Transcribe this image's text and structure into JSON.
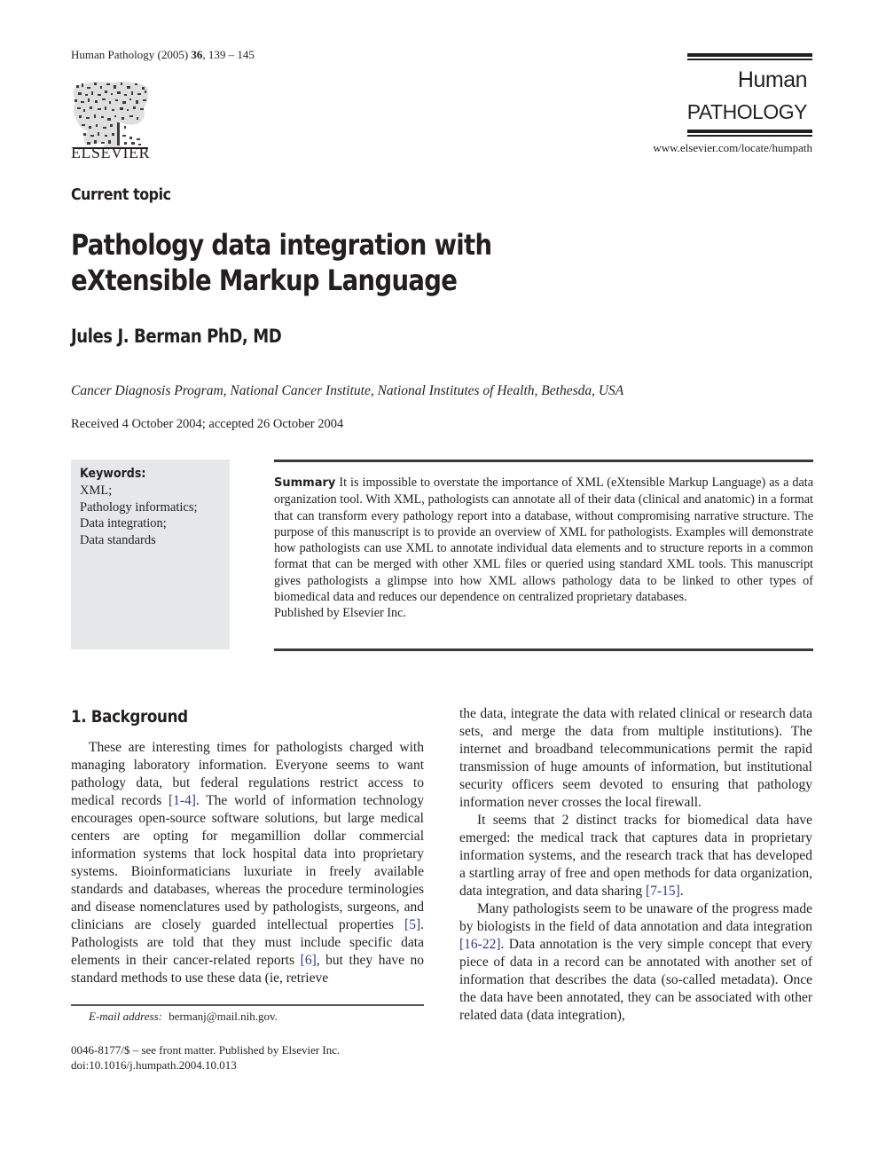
{
  "header": {
    "journal_name": "Human Pathology (2005)",
    "volume": "36",
    "pages": ", 139 – 145",
    "publisher_logo_text": "ELSEVIER",
    "brand_line1": "Human",
    "brand_line2": "PATHOLOGY",
    "journal_url": "www.elsevier.com/locate/humpath"
  },
  "article": {
    "type": "Current topic",
    "title": "Pathology data integration with eXtensible Markup Language",
    "author": "Jules J. Berman PhD, MD",
    "affiliation": "Cancer Diagnosis Program, National Cancer Institute, National Institutes of Health, Bethesda, USA",
    "received": "Received 4 October 2004; accepted 26 October 2004"
  },
  "keywords": {
    "heading": "Keywords:",
    "items": [
      "XML;",
      "Pathology informatics;",
      "Data integration;",
      "Data standards"
    ]
  },
  "summary": {
    "label": "Summary",
    "text": "It is impossible to overstate the importance of XML (eXtensible Markup Language) as a data organization tool. With XML, pathologists can annotate all of their data (clinical and anatomic) in a format that can transform every pathology report into a database, without compromising narrative structure. The purpose of this manuscript is to provide an overview of XML for pathologists. Examples will demonstrate how pathologists can use XML to annotate individual data elements and to structure reports in a common format that can be merged with other XML files or queried using standard XML tools. This manuscript gives pathologists a glimpse into how XML allows pathology data to be linked to other types of biomedical data and reduces our dependence on centralized proprietary databases.",
    "publisher_note": "Published by Elsevier Inc."
  },
  "body": {
    "section_heading": "1. Background",
    "left_p1_a": "These are interesting times for pathologists charged with managing laboratory information. Everyone seems to want pathology data, but federal regulations restrict access to medical records ",
    "cite_1_4": "[1-4]",
    "left_p1_b": ". The world of information technology encourages open-source software solutions, but large med­ical centers are opting for megamillion dollar commercial information systems that lock hospital data into proprietary systems. Bioinformaticians luxuriate in freely available standards and databases, whereas the procedure terminolo­gies and disease nomenclatures used by pathologists, surgeons, and clinicians are closely guarded intellectual properties ",
    "cite_5": "[5]",
    "left_p1_c": ". Pathologists are told that they must include specific data elements in their cancer-related reports ",
    "cite_6": "[6]",
    "left_p1_d": ", but they have no standard methods to use these data (ie, retrieve",
    "right_p1": "the data, integrate the data with related clinical or research data sets, and merge the data from multiple institutions). The internet and broadband telecommunications permit the rapid transmission of huge amounts of information, but institu­tional security officers seem devoted to ensuring that pathology information never crosses the local firewall.",
    "right_p2_a": "It seems that 2 distinct tracks for biomedical data have emerged: the medical track that captures data in proprietary information systems, and the research track that has developed a startling array of free and open methods for data organization, data integration, and data sharing ",
    "cite_7_15": "[7-15]",
    "right_p2_b": ".",
    "right_p3_a": "Many pathologists seem to be unaware of the progress made by biologists in the field of data annotation and data integration ",
    "cite_16_22": "[16-22]",
    "right_p3_b": ". Data annotation is the very simple concept that every piece of data in a record can be annotated with another set of information that describes the data (so-called metadata). Once the data have been annotated, they can be associated with other related data (data integration),"
  },
  "footer": {
    "email_label": "E-mail address:",
    "email": "bermanj@mail.nih.gov.",
    "front_matter": "0046-8177/$ – see front matter. Published by Elsevier Inc.",
    "doi": "doi:10.1016/j.humpath.2004.10.013"
  },
  "colors": {
    "text": "#231f20",
    "citation_link": "#2b3a8f",
    "keywords_bg": "#e6e7e8"
  }
}
